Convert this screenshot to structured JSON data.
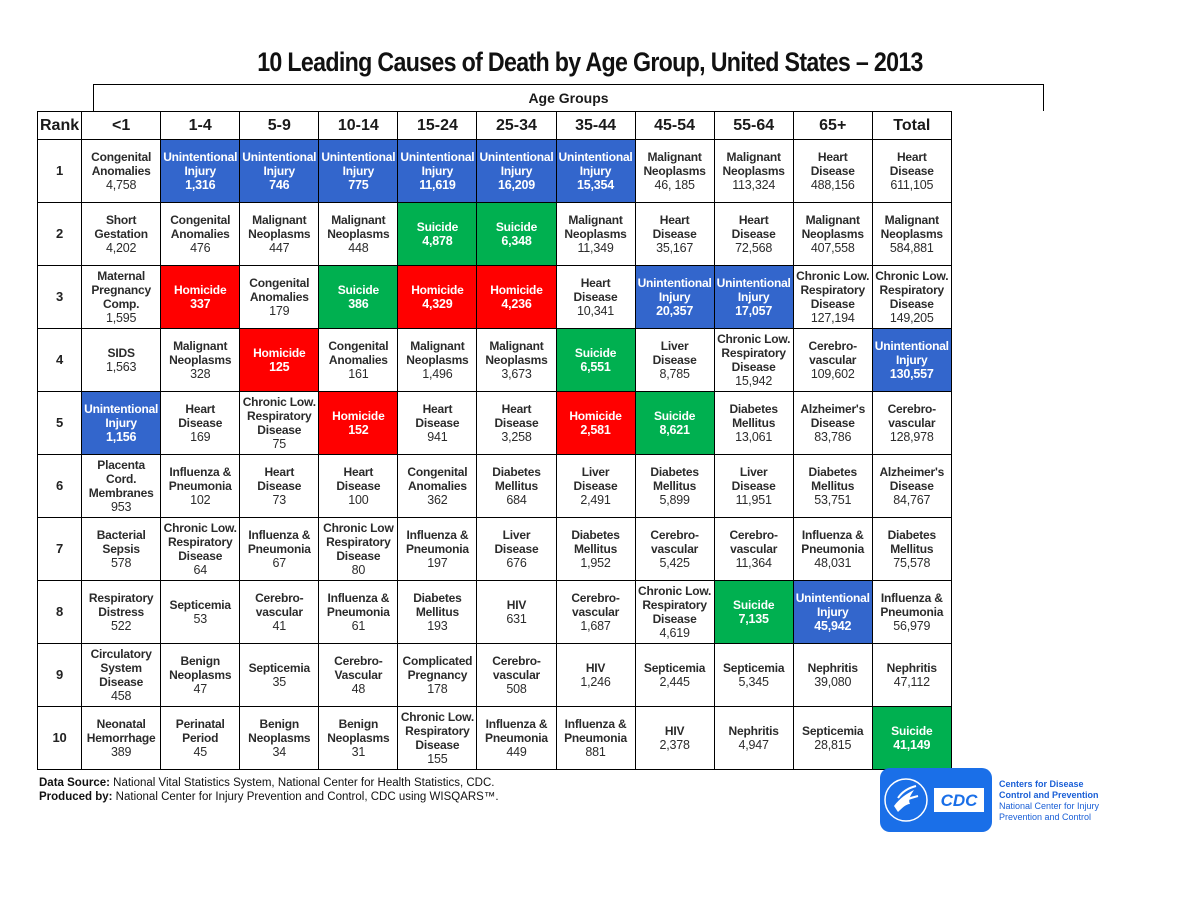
{
  "chart_data": {
    "type": "table",
    "title": "10 Leading Causes of Death by Age Group, United States – 2013",
    "group_header": "Age Groups",
    "rank_header": "Rank",
    "columns": [
      "<1",
      "1-4",
      "5-9",
      "10-14",
      "15-24",
      "25-34",
      "35-44",
      "45-54",
      "55-64",
      "65+",
      "Total"
    ],
    "legend": {
      "blue": {
        "label": "Unintentional Injury",
        "color": "#3366cc"
      },
      "red": {
        "label": "Homicide",
        "color": "#ff0000"
      },
      "green": {
        "label": "Suicide",
        "color": "#00b050"
      }
    },
    "rows": [
      {
        "rank": "1",
        "cells": [
          {
            "cause": "Congenital\nAnomalies",
            "value": "4,758",
            "cat": ""
          },
          {
            "cause": "Unintentional\nInjury",
            "value": "1,316",
            "cat": "blue"
          },
          {
            "cause": "Unintentional\nInjury",
            "value": "746",
            "cat": "blue"
          },
          {
            "cause": "Unintentional\nInjury",
            "value": "775",
            "cat": "blue"
          },
          {
            "cause": "Unintentional\nInjury",
            "value": "11,619",
            "cat": "blue"
          },
          {
            "cause": "Unintentional\nInjury",
            "value": "16,209",
            "cat": "blue"
          },
          {
            "cause": "Unintentional\nInjury",
            "value": "15,354",
            "cat": "blue"
          },
          {
            "cause": "Malignant\nNeoplasms",
            "value": "46, 185",
            "cat": ""
          },
          {
            "cause": "Malignant\nNeoplasms",
            "value": "113,324",
            "cat": ""
          },
          {
            "cause": "Heart\nDisease",
            "value": "488,156",
            "cat": ""
          },
          {
            "cause": "Heart\nDisease",
            "value": "611,105",
            "cat": ""
          }
        ]
      },
      {
        "rank": "2",
        "cells": [
          {
            "cause": "Short\nGestation",
            "value": "4,202",
            "cat": ""
          },
          {
            "cause": "Congenital\nAnomalies",
            "value": "476",
            "cat": ""
          },
          {
            "cause": "Malignant\nNeoplasms",
            "value": "447",
            "cat": ""
          },
          {
            "cause": "Malignant\nNeoplasms",
            "value": "448",
            "cat": ""
          },
          {
            "cause": "Suicide",
            "value": "4,878",
            "cat": "green"
          },
          {
            "cause": "Suicide",
            "value": "6,348",
            "cat": "green"
          },
          {
            "cause": "Malignant\nNeoplasms",
            "value": "11,349",
            "cat": ""
          },
          {
            "cause": "Heart\nDisease",
            "value": "35,167",
            "cat": ""
          },
          {
            "cause": "Heart\nDisease",
            "value": "72,568",
            "cat": ""
          },
          {
            "cause": "Malignant\nNeoplasms",
            "value": "407,558",
            "cat": ""
          },
          {
            "cause": "Malignant\nNeoplasms",
            "value": "584,881",
            "cat": ""
          }
        ]
      },
      {
        "rank": "3",
        "cells": [
          {
            "cause": "Maternal\nPregnancy\nComp.",
            "value": "1,595",
            "cat": ""
          },
          {
            "cause": "Homicide",
            "value": "337",
            "cat": "red"
          },
          {
            "cause": "Congenital\nAnomalies",
            "value": "179",
            "cat": ""
          },
          {
            "cause": "Suicide",
            "value": "386",
            "cat": "green"
          },
          {
            "cause": "Homicide",
            "value": "4,329",
            "cat": "red"
          },
          {
            "cause": "Homicide",
            "value": "4,236",
            "cat": "red"
          },
          {
            "cause": "Heart\nDisease",
            "value": "10,341",
            "cat": ""
          },
          {
            "cause": "Unintentional\nInjury",
            "value": "20,357",
            "cat": "blue"
          },
          {
            "cause": "Unintentional\nInjury",
            "value": "17,057",
            "cat": "blue"
          },
          {
            "cause": "Chronic Low.\nRespiratory\nDisease",
            "value": "127,194",
            "cat": ""
          },
          {
            "cause": "Chronic Low.\nRespiratory\nDisease",
            "value": "149,205",
            "cat": ""
          }
        ]
      },
      {
        "rank": "4",
        "cells": [
          {
            "cause": "SIDS",
            "value": "1,563",
            "cat": ""
          },
          {
            "cause": "Malignant\nNeoplasms",
            "value": "328",
            "cat": ""
          },
          {
            "cause": "Homicide",
            "value": "125",
            "cat": "red"
          },
          {
            "cause": "Congenital\nAnomalies",
            "value": "161",
            "cat": ""
          },
          {
            "cause": "Malignant\nNeoplasms",
            "value": "1,496",
            "cat": ""
          },
          {
            "cause": "Malignant\nNeoplasms",
            "value": "3,673",
            "cat": ""
          },
          {
            "cause": "Suicide",
            "value": "6,551",
            "cat": "green"
          },
          {
            "cause": "Liver\nDisease",
            "value": "8,785",
            "cat": ""
          },
          {
            "cause": "Chronic Low.\nRespiratory\nDisease",
            "value": "15,942",
            "cat": ""
          },
          {
            "cause": "Cerebro-\nvascular",
            "value": "109,602",
            "cat": ""
          },
          {
            "cause": "Unintentional\nInjury",
            "value": "130,557",
            "cat": "blue"
          }
        ]
      },
      {
        "rank": "5",
        "cells": [
          {
            "cause": "Unintentional\nInjury",
            "value": "1,156",
            "cat": "blue"
          },
          {
            "cause": "Heart\nDisease",
            "value": "169",
            "cat": ""
          },
          {
            "cause": "Chronic Low.\nRespiratory\nDisease",
            "value": "75",
            "cat": ""
          },
          {
            "cause": "Homicide",
            "value": "152",
            "cat": "red"
          },
          {
            "cause": "Heart\nDisease",
            "value": "941",
            "cat": ""
          },
          {
            "cause": "Heart\nDisease",
            "value": "3,258",
            "cat": ""
          },
          {
            "cause": "Homicide",
            "value": "2,581",
            "cat": "red"
          },
          {
            "cause": "Suicide",
            "value": "8,621",
            "cat": "green"
          },
          {
            "cause": "Diabetes\nMellitus",
            "value": "13,061",
            "cat": ""
          },
          {
            "cause": "Alzheimer's\nDisease",
            "value": "83,786",
            "cat": ""
          },
          {
            "cause": "Cerebro-\nvascular",
            "value": "128,978",
            "cat": ""
          }
        ]
      },
      {
        "rank": "6",
        "cells": [
          {
            "cause": "Placenta\nCord.\nMembranes",
            "value": "953",
            "cat": ""
          },
          {
            "cause": "Influenza &\nPneumonia",
            "value": "102",
            "cat": ""
          },
          {
            "cause": "Heart\nDisease",
            "value": "73",
            "cat": ""
          },
          {
            "cause": "Heart\nDisease",
            "value": "100",
            "cat": ""
          },
          {
            "cause": "Congenital\nAnomalies",
            "value": "362",
            "cat": ""
          },
          {
            "cause": "Diabetes\nMellitus",
            "value": "684",
            "cat": ""
          },
          {
            "cause": "Liver\nDisease",
            "value": "2,491",
            "cat": ""
          },
          {
            "cause": "Diabetes\nMellitus",
            "value": "5,899",
            "cat": ""
          },
          {
            "cause": "Liver\nDisease",
            "value": "11,951",
            "cat": ""
          },
          {
            "cause": "Diabetes\nMellitus",
            "value": "53,751",
            "cat": ""
          },
          {
            "cause": "Alzheimer's\nDisease",
            "value": "84,767",
            "cat": ""
          }
        ]
      },
      {
        "rank": "7",
        "cells": [
          {
            "cause": "Bacterial\nSepsis",
            "value": "578",
            "cat": ""
          },
          {
            "cause": "Chronic Low.\nRespiratory\nDisease",
            "value": "64",
            "cat": ""
          },
          {
            "cause": "Influenza &\nPneumonia",
            "value": "67",
            "cat": ""
          },
          {
            "cause": "Chronic Low\nRespiratory\nDisease",
            "value": "80",
            "cat": ""
          },
          {
            "cause": "Influenza &\nPneumonia",
            "value": "197",
            "cat": ""
          },
          {
            "cause": "Liver\nDisease",
            "value": "676",
            "cat": ""
          },
          {
            "cause": "Diabetes\nMellitus",
            "value": "1,952",
            "cat": ""
          },
          {
            "cause": "Cerebro-\nvascular",
            "value": "5,425",
            "cat": ""
          },
          {
            "cause": "Cerebro-\nvascular",
            "value": "11,364",
            "cat": ""
          },
          {
            "cause": "Influenza &\nPneumonia",
            "value": "48,031",
            "cat": ""
          },
          {
            "cause": "Diabetes\nMellitus",
            "value": "75,578",
            "cat": ""
          }
        ]
      },
      {
        "rank": "8",
        "cells": [
          {
            "cause": "Respiratory\nDistress",
            "value": "522",
            "cat": ""
          },
          {
            "cause": "Septicemia",
            "value": "53",
            "cat": ""
          },
          {
            "cause": "Cerebro-\nvascular",
            "value": "41",
            "cat": ""
          },
          {
            "cause": "Influenza &\nPneumonia",
            "value": "61",
            "cat": ""
          },
          {
            "cause": "Diabetes\nMellitus",
            "value": "193",
            "cat": ""
          },
          {
            "cause": "HIV",
            "value": "631",
            "cat": ""
          },
          {
            "cause": "Cerebro-\nvascular",
            "value": "1,687",
            "cat": ""
          },
          {
            "cause": "Chronic Low.\nRespiratory\nDisease",
            "value": "4,619",
            "cat": ""
          },
          {
            "cause": "Suicide",
            "value": "7,135",
            "cat": "green"
          },
          {
            "cause": "Unintentional\nInjury",
            "value": "45,942",
            "cat": "blue"
          },
          {
            "cause": "Influenza &\nPneumonia",
            "value": "56,979",
            "cat": ""
          }
        ]
      },
      {
        "rank": "9",
        "cells": [
          {
            "cause": "Circulatory\nSystem\nDisease",
            "value": "458",
            "cat": ""
          },
          {
            "cause": "Benign\nNeoplasms",
            "value": "47",
            "cat": ""
          },
          {
            "cause": "Septicemia",
            "value": "35",
            "cat": ""
          },
          {
            "cause": "Cerebro-\nVascular",
            "value": "48",
            "cat": ""
          },
          {
            "cause": "Complicated\nPregnancy",
            "value": "178",
            "cat": ""
          },
          {
            "cause": "Cerebro-\nvascular",
            "value": "508",
            "cat": ""
          },
          {
            "cause": "HIV",
            "value": "1,246",
            "cat": ""
          },
          {
            "cause": "Septicemia",
            "value": "2,445",
            "cat": ""
          },
          {
            "cause": "Septicemia",
            "value": "5,345",
            "cat": ""
          },
          {
            "cause": "Nephritis",
            "value": "39,080",
            "cat": ""
          },
          {
            "cause": "Nephritis",
            "value": "47,112",
            "cat": ""
          }
        ]
      },
      {
        "rank": "10",
        "cells": [
          {
            "cause": "Neonatal\nHemorrhage",
            "value": "389",
            "cat": ""
          },
          {
            "cause": "Perinatal\nPeriod",
            "value": "45",
            "cat": ""
          },
          {
            "cause": "Benign\nNeoplasms",
            "value": "34",
            "cat": ""
          },
          {
            "cause": "Benign\nNeoplasms",
            "value": "31",
            "cat": ""
          },
          {
            "cause": "Chronic Low.\nRespiratory\nDisease",
            "value": "155",
            "cat": ""
          },
          {
            "cause": "Influenza &\nPneumonia",
            "value": "449",
            "cat": ""
          },
          {
            "cause": "Influenza &\nPneumonia",
            "value": "881",
            "cat": ""
          },
          {
            "cause": "HIV",
            "value": "2,378",
            "cat": ""
          },
          {
            "cause": "Nephritis",
            "value": "4,947",
            "cat": ""
          },
          {
            "cause": "Septicemia",
            "value": "28,815",
            "cat": ""
          },
          {
            "cause": "Suicide",
            "value": "41,149",
            "cat": "green"
          }
        ]
      }
    ]
  },
  "footer": {
    "source_label": "Data Source:",
    "source_text": " National Vital Statistics System, National Center for Health Statistics, CDC.",
    "produced_label": "Produced by:",
    "produced_text": " National Center for Injury Prevention and Control, CDC using WISQARS™."
  },
  "logo": {
    "mark": "CDC",
    "line1": "Centers for Disease",
    "line2": "Control and Prevention",
    "line3": "National Center for Injury",
    "line4": "Prevention and Control"
  }
}
